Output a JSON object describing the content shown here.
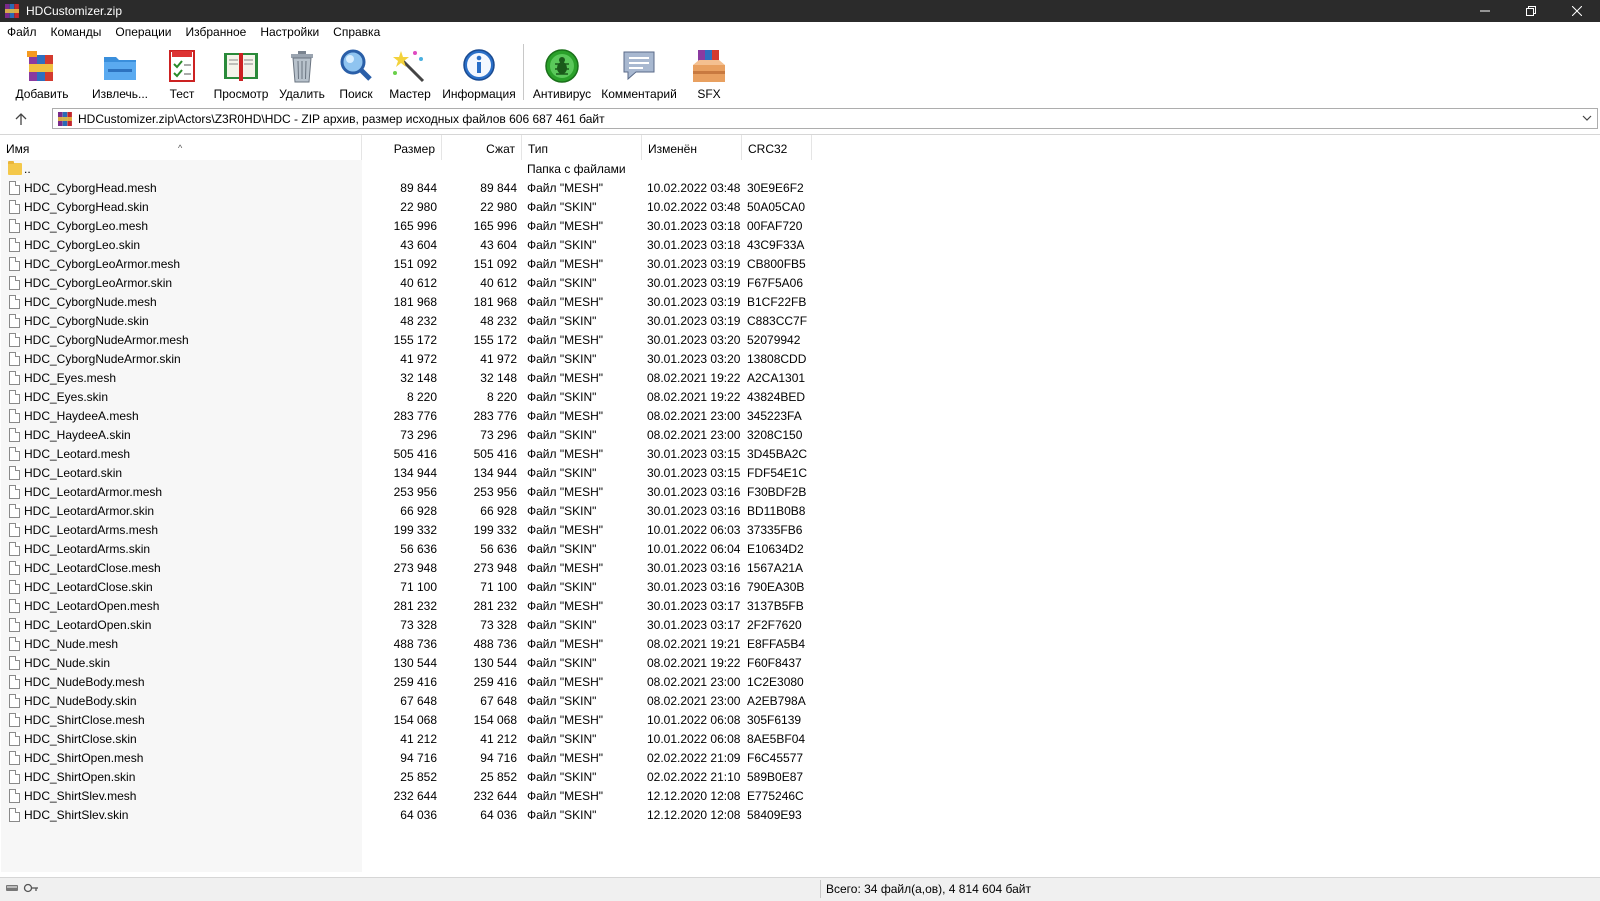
{
  "window": {
    "title": "HDCustomizer.zip"
  },
  "menu": [
    "Файл",
    "Команды",
    "Операции",
    "Избранное",
    "Настройки",
    "Справка"
  ],
  "toolbar": [
    {
      "label": "Добавить",
      "icon": "add-archive-icon"
    },
    {
      "label": "Извлечь...",
      "icon": "extract-folder-icon"
    },
    {
      "label": "Тест",
      "icon": "test-checklist-icon"
    },
    {
      "label": "Просмотр",
      "icon": "view-book-icon"
    },
    {
      "label": "Удалить",
      "icon": "trash-icon"
    },
    {
      "label": "Поиск",
      "icon": "magnifier-icon"
    },
    {
      "label": "Мастер",
      "icon": "wizard-wand-icon"
    },
    {
      "label": "Информация",
      "icon": "info-icon"
    },
    {
      "label": "Антивирус",
      "icon": "antivirus-bug-icon"
    },
    {
      "label": "Комментарий",
      "icon": "comment-icon"
    },
    {
      "label": "SFX",
      "icon": "sfx-box-icon"
    }
  ],
  "address": {
    "path": "HDCustomizer.zip\\Actors\\Z3R0HD\\HDC - ZIP архив, размер исходных файлов 606 687 461 байт"
  },
  "columns": {
    "name": "Имя",
    "size": "Размер",
    "packed": "Сжат",
    "type": "Тип",
    "modified": "Изменён",
    "crc": "CRC32"
  },
  "parent_row": {
    "name": "..",
    "type": "Папка с файлами"
  },
  "files": [
    [
      "HDC_CyborgHead.mesh",
      "89 844",
      "89 844",
      "Файл \"MESH\"",
      "10.02.2022 03:48",
      "30E9E6F2"
    ],
    [
      "HDC_CyborgHead.skin",
      "22 980",
      "22 980",
      "Файл \"SKIN\"",
      "10.02.2022 03:48",
      "50A05CA0"
    ],
    [
      "HDC_CyborgLeo.mesh",
      "165 996",
      "165 996",
      "Файл \"MESH\"",
      "30.01.2023 03:18",
      "00FAF720"
    ],
    [
      "HDC_CyborgLeo.skin",
      "43 604",
      "43 604",
      "Файл \"SKIN\"",
      "30.01.2023 03:18",
      "43C9F33A"
    ],
    [
      "HDC_CyborgLeoArmor.mesh",
      "151 092",
      "151 092",
      "Файл \"MESH\"",
      "30.01.2023 03:19",
      "CB800FB5"
    ],
    [
      "HDC_CyborgLeoArmor.skin",
      "40 612",
      "40 612",
      "Файл \"SKIN\"",
      "30.01.2023 03:19",
      "F67F5A06"
    ],
    [
      "HDC_CyborgNude.mesh",
      "181 968",
      "181 968",
      "Файл \"MESH\"",
      "30.01.2023 03:19",
      "B1CF22FB"
    ],
    [
      "HDC_CyborgNude.skin",
      "48 232",
      "48 232",
      "Файл \"SKIN\"",
      "30.01.2023 03:19",
      "C883CC7F"
    ],
    [
      "HDC_CyborgNudeArmor.mesh",
      "155 172",
      "155 172",
      "Файл \"MESH\"",
      "30.01.2023 03:20",
      "52079942"
    ],
    [
      "HDC_CyborgNudeArmor.skin",
      "41 972",
      "41 972",
      "Файл \"SKIN\"",
      "30.01.2023 03:20",
      "13808CDD"
    ],
    [
      "HDC_Eyes.mesh",
      "32 148",
      "32 148",
      "Файл \"MESH\"",
      "08.02.2021 19:22",
      "A2CA1301"
    ],
    [
      "HDC_Eyes.skin",
      "8 220",
      "8 220",
      "Файл \"SKIN\"",
      "08.02.2021 19:22",
      "43824BED"
    ],
    [
      "HDC_HaydeeA.mesh",
      "283 776",
      "283 776",
      "Файл \"MESH\"",
      "08.02.2021 23:00",
      "345223FA"
    ],
    [
      "HDC_HaydeeA.skin",
      "73 296",
      "73 296",
      "Файл \"SKIN\"",
      "08.02.2021 23:00",
      "3208C150"
    ],
    [
      "HDC_Leotard.mesh",
      "505 416",
      "505 416",
      "Файл \"MESH\"",
      "30.01.2023 03:15",
      "3D45BA2C"
    ],
    [
      "HDC_Leotard.skin",
      "134 944",
      "134 944",
      "Файл \"SKIN\"",
      "30.01.2023 03:15",
      "FDF54E1C"
    ],
    [
      "HDC_LeotardArmor.mesh",
      "253 956",
      "253 956",
      "Файл \"MESH\"",
      "30.01.2023 03:16",
      "F30BDF2B"
    ],
    [
      "HDC_LeotardArmor.skin",
      "66 928",
      "66 928",
      "Файл \"SKIN\"",
      "30.01.2023 03:16",
      "BD11B0B8"
    ],
    [
      "HDC_LeotardArms.mesh",
      "199 332",
      "199 332",
      "Файл \"MESH\"",
      "10.01.2022 06:03",
      "37335FB6"
    ],
    [
      "HDC_LeotardArms.skin",
      "56 636",
      "56 636",
      "Файл \"SKIN\"",
      "10.01.2022 06:04",
      "E10634D2"
    ],
    [
      "HDC_LeotardClose.mesh",
      "273 948",
      "273 948",
      "Файл \"MESH\"",
      "30.01.2023 03:16",
      "1567A21A"
    ],
    [
      "HDC_LeotardClose.skin",
      "71 100",
      "71 100",
      "Файл \"SKIN\"",
      "30.01.2023 03:16",
      "790EA30B"
    ],
    [
      "HDC_LeotardOpen.mesh",
      "281 232",
      "281 232",
      "Файл \"MESH\"",
      "30.01.2023 03:17",
      "3137B5FB"
    ],
    [
      "HDC_LeotardOpen.skin",
      "73 328",
      "73 328",
      "Файл \"SKIN\"",
      "30.01.2023 03:17",
      "2F2F7620"
    ],
    [
      "HDC_Nude.mesh",
      "488 736",
      "488 736",
      "Файл \"MESH\"",
      "08.02.2021 19:21",
      "E8FFA5B4"
    ],
    [
      "HDC_Nude.skin",
      "130 544",
      "130 544",
      "Файл \"SKIN\"",
      "08.02.2021 19:22",
      "F60F8437"
    ],
    [
      "HDC_NudeBody.mesh",
      "259 416",
      "259 416",
      "Файл \"MESH\"",
      "08.02.2021 23:00",
      "1C2E3080"
    ],
    [
      "HDC_NudeBody.skin",
      "67 648",
      "67 648",
      "Файл \"SKIN\"",
      "08.02.2021 23:00",
      "A2EB798A"
    ],
    [
      "HDC_ShirtClose.mesh",
      "154 068",
      "154 068",
      "Файл \"MESH\"",
      "10.01.2022 06:08",
      "305F6139"
    ],
    [
      "HDC_ShirtClose.skin",
      "41 212",
      "41 212",
      "Файл \"SKIN\"",
      "10.01.2022 06:08",
      "8AE5BF04"
    ],
    [
      "HDC_ShirtOpen.mesh",
      "94 716",
      "94 716",
      "Файл \"MESH\"",
      "02.02.2022 21:09",
      "F6C45577"
    ],
    [
      "HDC_ShirtOpen.skin",
      "25 852",
      "25 852",
      "Файл \"SKIN\"",
      "02.02.2022 21:10",
      "589B0E87"
    ],
    [
      "HDC_ShirtSlev.mesh",
      "232 644",
      "232 644",
      "Файл \"MESH\"",
      "12.12.2020 12:08",
      "E775246C"
    ],
    [
      "HDC_ShirtSlev.skin",
      "64 036",
      "64 036",
      "Файл \"SKIN\"",
      "12.12.2020 12:08",
      "58409E93"
    ]
  ],
  "status": {
    "summary": "Всего: 34 файл(а,ов), 4 814 604 байт"
  },
  "colors": {
    "titlebar": "#2b2b2b",
    "name_column_bg": "#f7f7f7",
    "statusbar": "#f0f0f0"
  }
}
